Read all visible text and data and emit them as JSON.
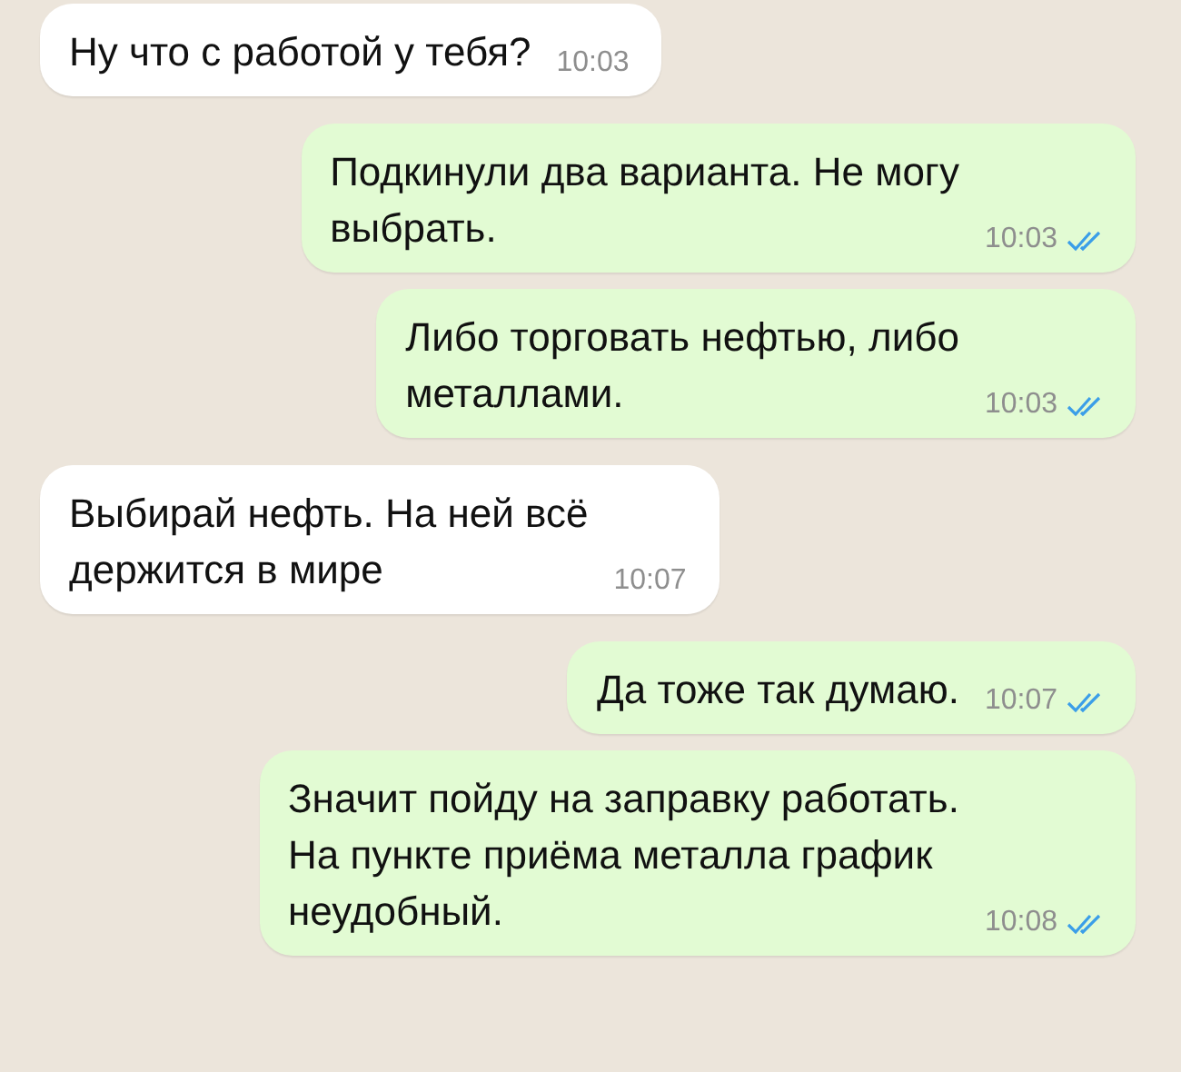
{
  "messages": [
    {
      "kind": "incoming",
      "lines": [
        "Ну что с работой у тебя?"
      ],
      "time": "10:03"
    },
    {
      "kind": "outgoing",
      "lines": [
        "Подкинули два варианта. Не могу",
        "выбрать."
      ],
      "time": "10:03",
      "read": true
    },
    {
      "kind": "outgoing",
      "lines": [
        "Либо торговать нефтью, либо",
        "металлами."
      ],
      "time": "10:03",
      "read": true
    },
    {
      "kind": "incoming",
      "lines": [
        "Выбирай нефть. На ней всё",
        "держится в мире"
      ],
      "time": "10:07"
    },
    {
      "kind": "outgoing",
      "lines": [
        "Да тоже так думаю."
      ],
      "time": "10:07",
      "read": true
    },
    {
      "kind": "outgoing",
      "lines": [
        "Значит пойду на заправку работать.",
        "На пункте приёма металла график",
        "неудобный."
      ],
      "time": "10:08",
      "read": true
    }
  ]
}
